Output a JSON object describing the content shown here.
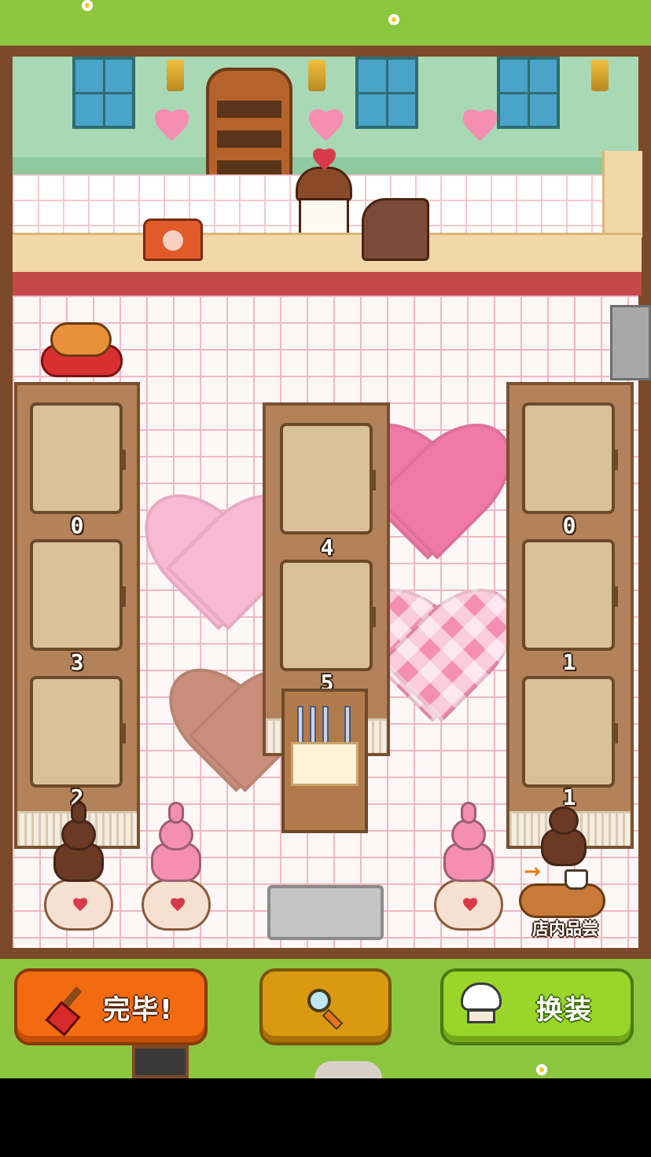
{
  "shop": {
    "cabinet_counts": {
      "left": [
        "0",
        "3",
        "2"
      ],
      "middle": [
        "4",
        "5"
      ],
      "right": [
        "0",
        "1",
        "1"
      ]
    },
    "tasting_label": "店内品尝"
  },
  "toolbar": {
    "done_label": "完毕!",
    "outfit_label": "换装"
  },
  "icons": {
    "done": "paintbrush-icon",
    "search": "magnifier-icon",
    "outfit": "chef-hat-icon"
  },
  "colors": {
    "done_button": "#f26b10",
    "search_button": "#d99a12",
    "outfit_button": "#9ad62a",
    "grass": "#8cc63f"
  }
}
